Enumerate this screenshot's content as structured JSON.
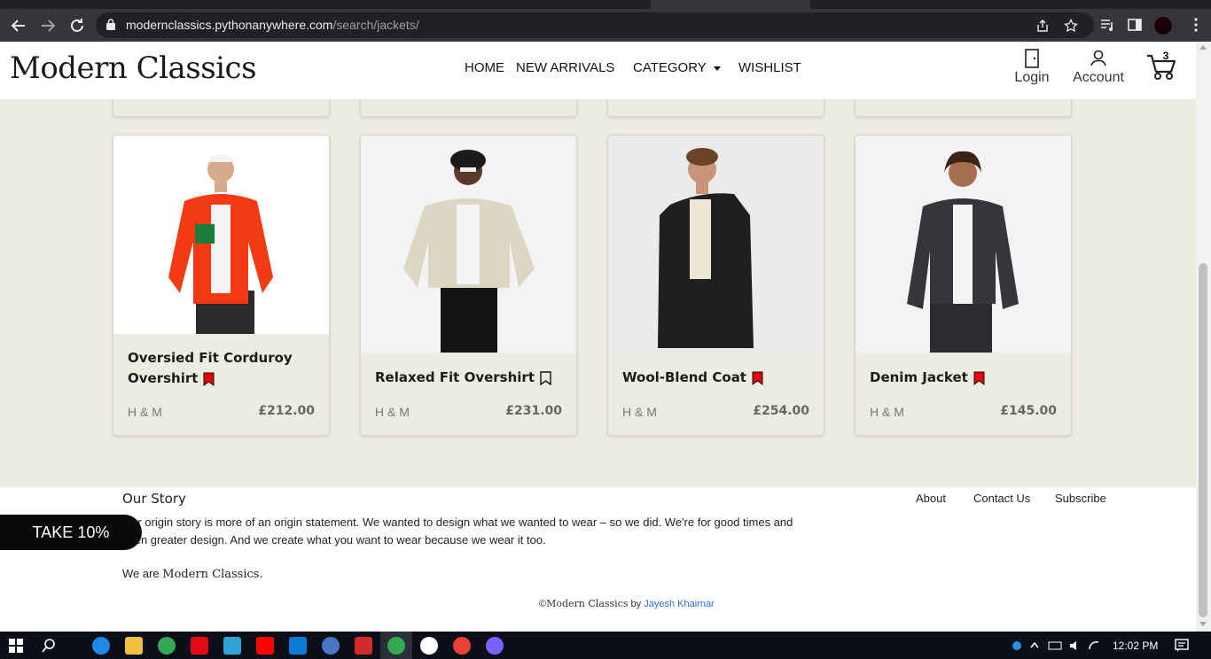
{
  "browser": {
    "url_host": "modernclassics.pythonanywhere.com",
    "url_path": "/search/jackets/"
  },
  "header": {
    "brand": "Modern Classics",
    "nav": [
      "HOME",
      "NEW ARRIVALS",
      "CATEGORY",
      "WISHLIST"
    ],
    "login_label": "Login",
    "account_label": "Account",
    "cart_count": "3"
  },
  "products": [
    {
      "name_line1": "Oversied Fit Corduroy",
      "name_line2": "Overshirt",
      "brand": "H & M",
      "price": "£212.00",
      "wishlisted": true
    },
    {
      "name_line1": "Relaxed Fit Overshirt",
      "brand": "H & M",
      "price": "£231.00",
      "wishlisted": false
    },
    {
      "name_line1": "Wool-Blend Coat",
      "brand": "H & M",
      "price": "£254.00",
      "wishlisted": true
    },
    {
      "name_line1": "Denim Jacket",
      "brand": "H & M",
      "price": "£145.00",
      "wishlisted": true
    }
  ],
  "footer": {
    "story_title": "Our Story",
    "story_text": "Our origin story is more of an origin statement. We wanted to design what we wanted to wear – so we did. We're for good times and even greater design. And we create what you want to wear because we wear it too.",
    "tagline_prefix": "We are ",
    "tagline_brand": "Modern Classics.",
    "links": [
      "About",
      "Contact Us",
      "Subscribe"
    ],
    "copy_symbol": "©",
    "copy_brand": "Modern Classics",
    "copy_by": " by ",
    "copy_author": "Jayesh Khairnar"
  },
  "promo": {
    "label": "TAKE 10%"
  },
  "taskbar": {
    "time": "12:02 PM"
  },
  "colors": {
    "wishlist_red": "#e8000b",
    "page_bg": "#edece0",
    "link_blue": "#2a6bd6"
  }
}
